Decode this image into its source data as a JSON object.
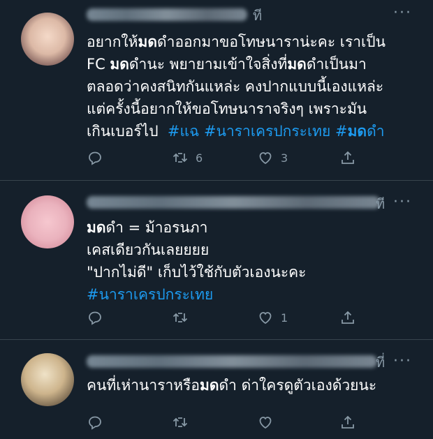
{
  "tweets": [
    {
      "time_suffix": "ที",
      "lines": [
        {
          "parts": [
            {
              "t": "อยากให้",
              "b": false
            },
            {
              "t": "มด",
              "b": true
            },
            {
              "t": "ดำออกมาขอโทษนาราน่ะคะ เราเป็น",
              "b": false
            }
          ]
        },
        {
          "parts": [
            {
              "t": "FC ",
              "b": false
            },
            {
              "t": "มด",
              "b": true
            },
            {
              "t": "ดำนะ พยายามเข้าใจสิ่งที่",
              "b": false
            },
            {
              "t": "มด",
              "b": true
            },
            {
              "t": "ดำเป็นมา",
              "b": false
            }
          ]
        },
        {
          "parts": [
            {
              "t": "ตลอดว่าคงสนิทกันแหล่ะ คงปากแบบนี้เองแหล่ะ",
              "b": false
            }
          ]
        },
        {
          "parts": [
            {
              "t": "แต่ครั้งนี้อยากให้ขอโทษนาราจริงๆ เพราะมัน",
              "b": false
            }
          ]
        }
      ],
      "last_line": "เกินเบอร์ไป",
      "hashtags": [
        "#แฉ",
        "#นาราเครปกระเทย",
        "#"
      ],
      "hashtag_bold_tail": "มด",
      "hashtag_tail": "ดำ",
      "reply_count": "",
      "retweet_count": "6",
      "like_count": "3"
    },
    {
      "time_suffix": "ที",
      "line1_bold": "มด",
      "line1_rest": "ดำ  = ม้าอรนภา",
      "line2": "เคสเดียวกันเลยยยย",
      "line3": "\"ปากไม่ดี\" เก็บไว้ใช้กับตัวเองนะคะ",
      "line4": "#นาราเครปกระเทย",
      "retweet_count": "",
      "like_count": "1"
    },
    {
      "time_suffix": "ที่",
      "pre": "คนที่เห่านาราหรือ",
      "bold": "มด",
      "post": "ดำ ด่าใครดูตัวเองด้วยนะ"
    }
  ],
  "icons": {
    "reply": "reply-icon",
    "retweet": "retweet-icon",
    "like": "like-icon",
    "share": "share-icon",
    "more": "more-icon"
  },
  "colors": {
    "background": "#15202b",
    "text": "#ffffff",
    "muted": "#8899a6",
    "link": "#1d9bf0",
    "divider": "#38444d"
  }
}
